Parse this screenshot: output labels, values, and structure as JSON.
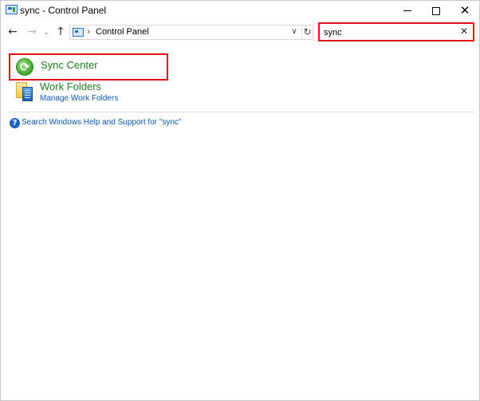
{
  "window": {
    "title": "sync - Control Panel",
    "controls": {
      "minimize": "—",
      "maximize": "",
      "close": "✕"
    }
  },
  "navbar": {
    "back_glyph": "←",
    "forward_glyph": "→",
    "recent_glyph": "⌄",
    "up_glyph": "↑",
    "address": {
      "separator": "›",
      "crumb": "Control Panel",
      "dropdown_glyph": "∨",
      "refresh_glyph": "↻"
    },
    "search": {
      "value": "sync",
      "clear_glyph": "✕"
    }
  },
  "results": {
    "sync_center": {
      "title": "Sync Center",
      "icon": "sync-icon"
    },
    "work_folders": {
      "title": "Work Folders",
      "link": "Manage Work Folders",
      "icon": "work-folders-icon"
    }
  },
  "help": {
    "icon_glyph": "?",
    "link": "Search Windows Help and Support for \"sync\""
  },
  "colors": {
    "highlight": "#e0101c",
    "title_green": "#1e7b1e",
    "link_blue": "#0b57b4"
  }
}
